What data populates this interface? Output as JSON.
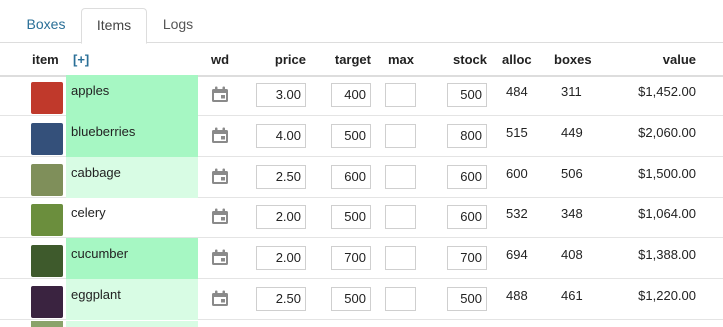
{
  "tabs": [
    {
      "label": "Boxes"
    },
    {
      "label": "Items"
    },
    {
      "label": "Logs"
    }
  ],
  "header": {
    "item": "item",
    "add": "[+]",
    "wd": "wd",
    "price": "price",
    "target": "target",
    "max": "max",
    "stock": "stock",
    "alloc": "alloc",
    "boxes": "boxes",
    "value": "value"
  },
  "colors": {
    "link": "#2a6f97",
    "highlight_strong": "#a6f7c3",
    "highlight_light": "#d8fce4",
    "calendar_icon": "#8a8a8a"
  },
  "rows": [
    {
      "name": "apples",
      "price": "3.00",
      "target": "400",
      "max": "",
      "stock": "500",
      "alloc": "484",
      "boxes": "311",
      "value": "$1,452.00",
      "highlight": "strong",
      "thumb": "apples-thumbnail",
      "thumb_color": "#c0392b"
    },
    {
      "name": "blueberries",
      "price": "4.00",
      "target": "500",
      "max": "",
      "stock": "800",
      "alloc": "515",
      "boxes": "449",
      "value": "$2,060.00",
      "highlight": "strong",
      "thumb": "blueberries-thumbnail",
      "thumb_color": "#34507a"
    },
    {
      "name": "cabbage",
      "price": "2.50",
      "target": "600",
      "max": "",
      "stock": "600",
      "alloc": "600",
      "boxes": "506",
      "value": "$1,500.00",
      "highlight": "light",
      "thumb": "cabbage-thumbnail",
      "thumb_color": "#7f8f5a"
    },
    {
      "name": "celery",
      "price": "2.00",
      "target": "500",
      "max": "",
      "stock": "600",
      "alloc": "532",
      "boxes": "348",
      "value": "$1,064.00",
      "highlight": "none",
      "thumb": "celery-thumbnail",
      "thumb_color": "#6b8e3d"
    },
    {
      "name": "cucumber",
      "price": "2.00",
      "target": "700",
      "max": "",
      "stock": "700",
      "alloc": "694",
      "boxes": "408",
      "value": "$1,388.00",
      "highlight": "strong",
      "thumb": "cucumber-thumbnail",
      "thumb_color": "#3e5a2c"
    },
    {
      "name": "eggplant",
      "price": "2.50",
      "target": "500",
      "max": "",
      "stock": "500",
      "alloc": "488",
      "boxes": "461",
      "value": "$1,220.00",
      "highlight": "light",
      "thumb": "eggplant-thumbnail",
      "thumb_color": "#3a2340"
    }
  ]
}
